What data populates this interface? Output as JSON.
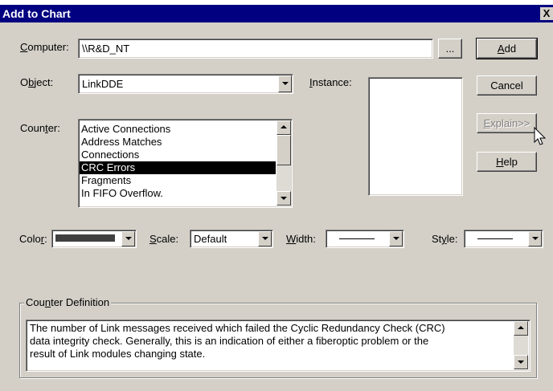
{
  "window": {
    "title": "Add to Chart",
    "close_glyph": "X"
  },
  "computer": {
    "label_key": "C",
    "label_rest": "omputer:",
    "value": "\\\\R&D_NT",
    "browse_label": "..."
  },
  "object": {
    "label_pre": "O",
    "label_key": "b",
    "label_rest": "ject:",
    "value": "LinkDDE"
  },
  "instance": {
    "label_key": "I",
    "label_rest": "nstance:"
  },
  "counter": {
    "label_pre": "Coun",
    "label_key": "t",
    "label_rest": "er:",
    "items": [
      "Active Connections",
      "Address Matches",
      "Connections",
      "CRC Errors",
      "Fragments",
      "In FIFO Overflow."
    ],
    "selected_index": 3
  },
  "buttons": {
    "add_key": "A",
    "add_rest": "dd",
    "cancel": "Cancel",
    "explain_key": "E",
    "explain_rest": "xplain>>",
    "help_key": "H",
    "help_rest": "elp"
  },
  "options": {
    "color_pre": "Colo",
    "color_key": "r",
    "color_rest": ":",
    "color_value": "#404040",
    "scale_key": "S",
    "scale_rest": "cale:",
    "scale_value": "Default",
    "width_key": "W",
    "width_rest": "idth:",
    "style_pre": "St",
    "style_key": "y",
    "style_rest": "le:"
  },
  "definition": {
    "legend_pre": "Cou",
    "legend_key": "n",
    "legend_rest": "ter Definition",
    "lines": [
      "The number of Link messages received which failed the Cyclic Redundancy Check (CRC)",
      "data integrity check. Generally, this is an indication of either a fiberoptic problem or the",
      "result of Link modules changing state."
    ]
  }
}
